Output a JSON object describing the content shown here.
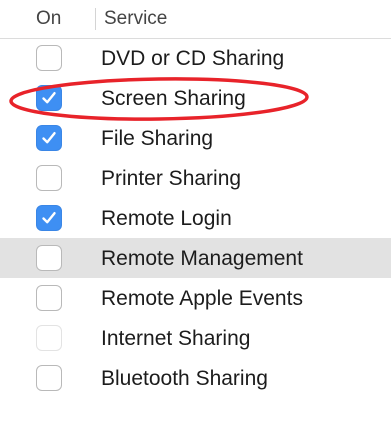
{
  "header": {
    "on_label": "On",
    "service_label": "Service"
  },
  "services": [
    {
      "label": "DVD or CD Sharing",
      "checked": false
    },
    {
      "label": "Screen Sharing",
      "checked": true
    },
    {
      "label": "File Sharing",
      "checked": true
    },
    {
      "label": "Printer Sharing",
      "checked": false
    },
    {
      "label": "Remote Login",
      "checked": true
    },
    {
      "label": "Remote Management",
      "checked": false,
      "selected": true
    },
    {
      "label": "Remote Apple Events",
      "checked": false
    },
    {
      "label": "Internet Sharing",
      "checked": false,
      "disabled": true
    },
    {
      "label": "Bluetooth Sharing",
      "checked": false
    }
  ],
  "colors": {
    "checkbox_checked": "#3e8ff3",
    "selected_row": "#e2e2e2",
    "annotation_circle": "#e8232a"
  }
}
